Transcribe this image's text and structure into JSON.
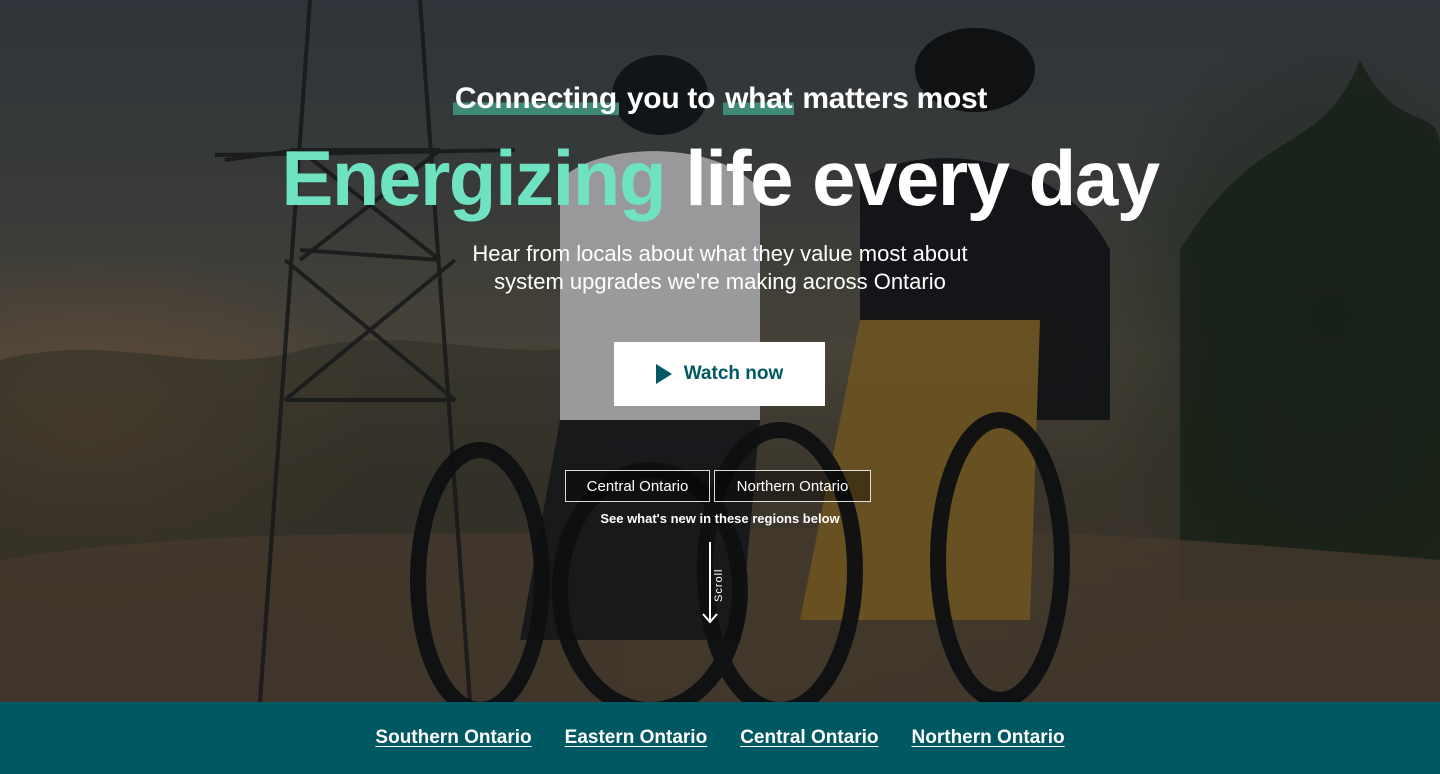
{
  "hero": {
    "tagline_part1": "Connecting",
    "tagline_part2": " you to ",
    "tagline_part3": "what",
    "tagline_part4": " matters most",
    "headline_accent": "Energizing",
    "headline_rest": " life every day",
    "subtitle_line1": "Hear from locals about what they value most about",
    "subtitle_line2": "system upgrades we're making across Ontario",
    "watch_button": "Watch now",
    "region_tags": [
      "Central Ontario",
      "Northern Ontario"
    ],
    "regions_note": "See what's new in these regions below",
    "scroll_label": "Scroll"
  },
  "region_nav": {
    "links": [
      "Southern Ontario",
      "Eastern Ontario",
      "Central Ontario",
      "Northern Ontario"
    ]
  },
  "colors": {
    "accent_green": "#6fe3c1",
    "brand_teal": "#005863",
    "highlight_green": "#3f8a74"
  },
  "icons": [
    "play-icon",
    "scroll-arrow-icon"
  ]
}
